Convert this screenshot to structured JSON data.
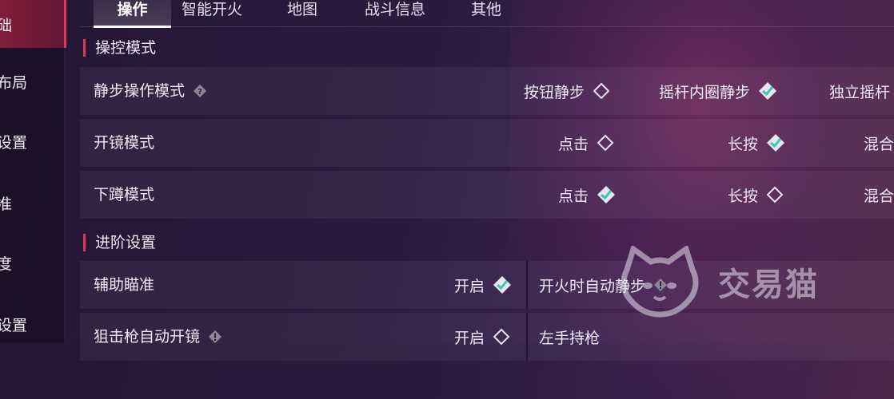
{
  "sidebar": {
    "items": [
      {
        "label": "础",
        "active": true
      },
      {
        "label": "布局",
        "active": false
      },
      {
        "label": "设置",
        "active": false
      },
      {
        "label": "准",
        "active": false
      },
      {
        "label": "度",
        "active": false
      },
      {
        "label": "设置",
        "active": false
      }
    ]
  },
  "tabs": [
    {
      "label": "操作",
      "active": true
    },
    {
      "label": "智能开火",
      "active": false
    },
    {
      "label": "地图",
      "active": false
    },
    {
      "label": "战斗信息",
      "active": false
    },
    {
      "label": "其他",
      "active": false
    }
  ],
  "sections": {
    "control_mode": "操控模式",
    "advanced": "进阶设置"
  },
  "rows": {
    "quiet_step": {
      "label": "静步操作模式",
      "options": [
        {
          "label": "按钮静步",
          "checked": false
        },
        {
          "label": "摇杆内圈静步",
          "checked": true
        },
        {
          "label": "独立摇杆",
          "checked": false
        }
      ]
    },
    "scope": {
      "label": "开镜模式",
      "options": [
        {
          "label": "点击",
          "checked": false
        },
        {
          "label": "长按",
          "checked": true
        },
        {
          "label": "混合",
          "checked": false
        }
      ]
    },
    "crouch": {
      "label": "下蹲模式",
      "options": [
        {
          "label": "点击",
          "checked": true
        },
        {
          "label": "长按",
          "checked": false
        },
        {
          "label": "混合",
          "checked": false
        }
      ]
    },
    "aim_assist": {
      "label": "辅助瞄准",
      "option": {
        "label": "开启",
        "checked": true
      },
      "right_label": "开火时自动静步"
    },
    "sniper_scope": {
      "label": "狙击枪自动开镜",
      "option": {
        "label": "开启",
        "checked": false
      },
      "right_label": "左手持枪"
    }
  },
  "watermark": {
    "text": "交易猫"
  },
  "colors": {
    "accent": "#e0375e",
    "check": "#36c9b4"
  }
}
